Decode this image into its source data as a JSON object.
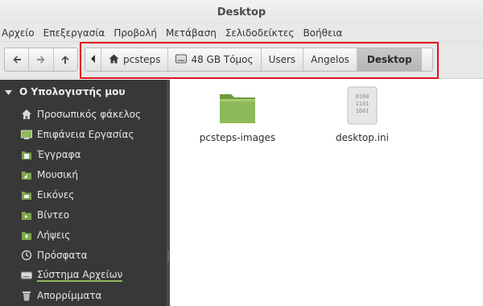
{
  "window": {
    "title": "Desktop"
  },
  "menu": [
    "Αρχείο",
    "Επεξεργασία",
    "Προβολή",
    "Μετάβαση",
    "Σελιδοδείκτες",
    "Βοήθεια"
  ],
  "toolbar": {
    "nav": [
      {
        "name": "back-button",
        "icon": "arrow-left-icon"
      },
      {
        "name": "forward-button",
        "icon": "arrow-right-icon"
      },
      {
        "name": "up-button",
        "icon": "arrow-up-icon"
      }
    ]
  },
  "pathbar": {
    "back_icon": "chevron-left-icon",
    "crumbs": [
      {
        "label": "pcsteps",
        "icon": "home-icon",
        "active": false
      },
      {
        "label": "48 GB Τόμος",
        "icon": "drive-icon",
        "active": false
      },
      {
        "label": "Users",
        "icon": "",
        "active": false
      },
      {
        "label": "Angelos",
        "icon": "",
        "active": false
      },
      {
        "label": "Desktop",
        "icon": "",
        "active": true
      }
    ],
    "highlight_color": "#e2121c"
  },
  "sidebar": {
    "header": "Ο Υπολογιστής μου",
    "items": [
      {
        "label": "Προσωπικός φάκελος",
        "icon": "home-icon"
      },
      {
        "label": "Επιφάνεια Εργασίας",
        "icon": "desktop-icon"
      },
      {
        "label": "Έγγραφα",
        "icon": "documents-folder-icon"
      },
      {
        "label": "Μουσική",
        "icon": "music-folder-icon"
      },
      {
        "label": "Εικόνες",
        "icon": "pictures-folder-icon"
      },
      {
        "label": "Βίντεο",
        "icon": "videos-folder-icon"
      },
      {
        "label": "Λήψεις",
        "icon": "downloads-folder-icon"
      },
      {
        "label": "Πρόσφατα",
        "icon": "recent-icon"
      },
      {
        "label": "Σύστημα Αρχείων",
        "icon": "filesystem-icon"
      },
      {
        "label": "Απορρίμματα",
        "icon": "trash-icon"
      }
    ]
  },
  "files": [
    {
      "name": "pcsteps-images",
      "icon": "folder-icon"
    },
    {
      "name": "desktop.ini",
      "icon": "binary-file-icon",
      "glyph_lines": [
        "0100",
        "1101",
        "1001"
      ]
    }
  ],
  "colors": {
    "sidebar_bg": "#383838",
    "folder_green": "#8dba5a",
    "accent_underline": "#8fb85a"
  }
}
